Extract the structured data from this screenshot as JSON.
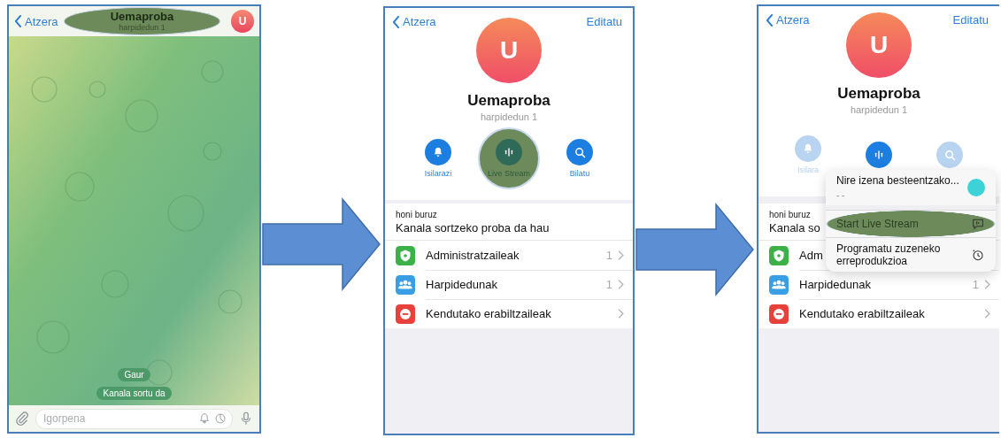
{
  "panels": [
    {
      "kind": "chat",
      "back": "Atzera",
      "title": "Uemaproba",
      "subtitle": "harpidedun 1",
      "title_highlighted": true,
      "avatar": "U",
      "messages": [
        "Gaur",
        "Kanala sortu da"
      ],
      "input": {
        "placeholder": "Igorpena"
      }
    },
    {
      "kind": "profile",
      "back": "Atzera",
      "edit": "Editatu",
      "avatar": "U",
      "name": "Uemaproba",
      "subtitle": "harpidedun 1",
      "actions": [
        {
          "label": "Isilarazi",
          "dimmed": false,
          "highlighted": false
        },
        {
          "label": "Live Stream",
          "dimmed": false,
          "highlighted": true
        },
        {
          "label": "Bilatu",
          "dimmed": false,
          "highlighted": false
        }
      ],
      "about": {
        "label": "honi buruz",
        "text": "Kanala sortzeko proba da hau"
      },
      "rows": [
        {
          "label": "Administratzaileak",
          "count": "1",
          "chevron": true
        },
        {
          "label": "Harpidedunak",
          "count": "1",
          "chevron": true
        },
        {
          "label": "Kendutako erabiltzaileak",
          "chevron": true
        }
      ]
    },
    {
      "kind": "profile",
      "back": "Atzera",
      "edit": "Editatu",
      "avatar": "U",
      "name": "Uemaproba",
      "subtitle": "harpidedun 1",
      "actions": [
        {
          "label": "Isilara",
          "dimmed": true,
          "highlighted": false
        },
        {
          "dimmed": false,
          "highlighted": false
        },
        {
          "dimmed": true,
          "highlighted": false
        }
      ],
      "about": {
        "label": "honi buruz",
        "text": "Kanala so"
      },
      "rows": [
        {
          "label": "Adm",
          "chevron": false
        },
        {
          "label": "Harpidedunak",
          "count": "1",
          "chevron": true
        },
        {
          "label": "Kendutako erabiltzaileak",
          "chevron": true
        }
      ],
      "menu": {
        "items": [
          {
            "kind": "account",
            "label": "Nire izena besteentzako...",
            "sublabel": "- -",
            "highlighted": false
          },
          {
            "kind": "action",
            "label": "Start Live Stream",
            "highlighted": true
          },
          {
            "kind": "action",
            "label": "Programatu zuzeneko erreprodukzioa",
            "highlighted": false
          }
        ]
      }
    }
  ]
}
